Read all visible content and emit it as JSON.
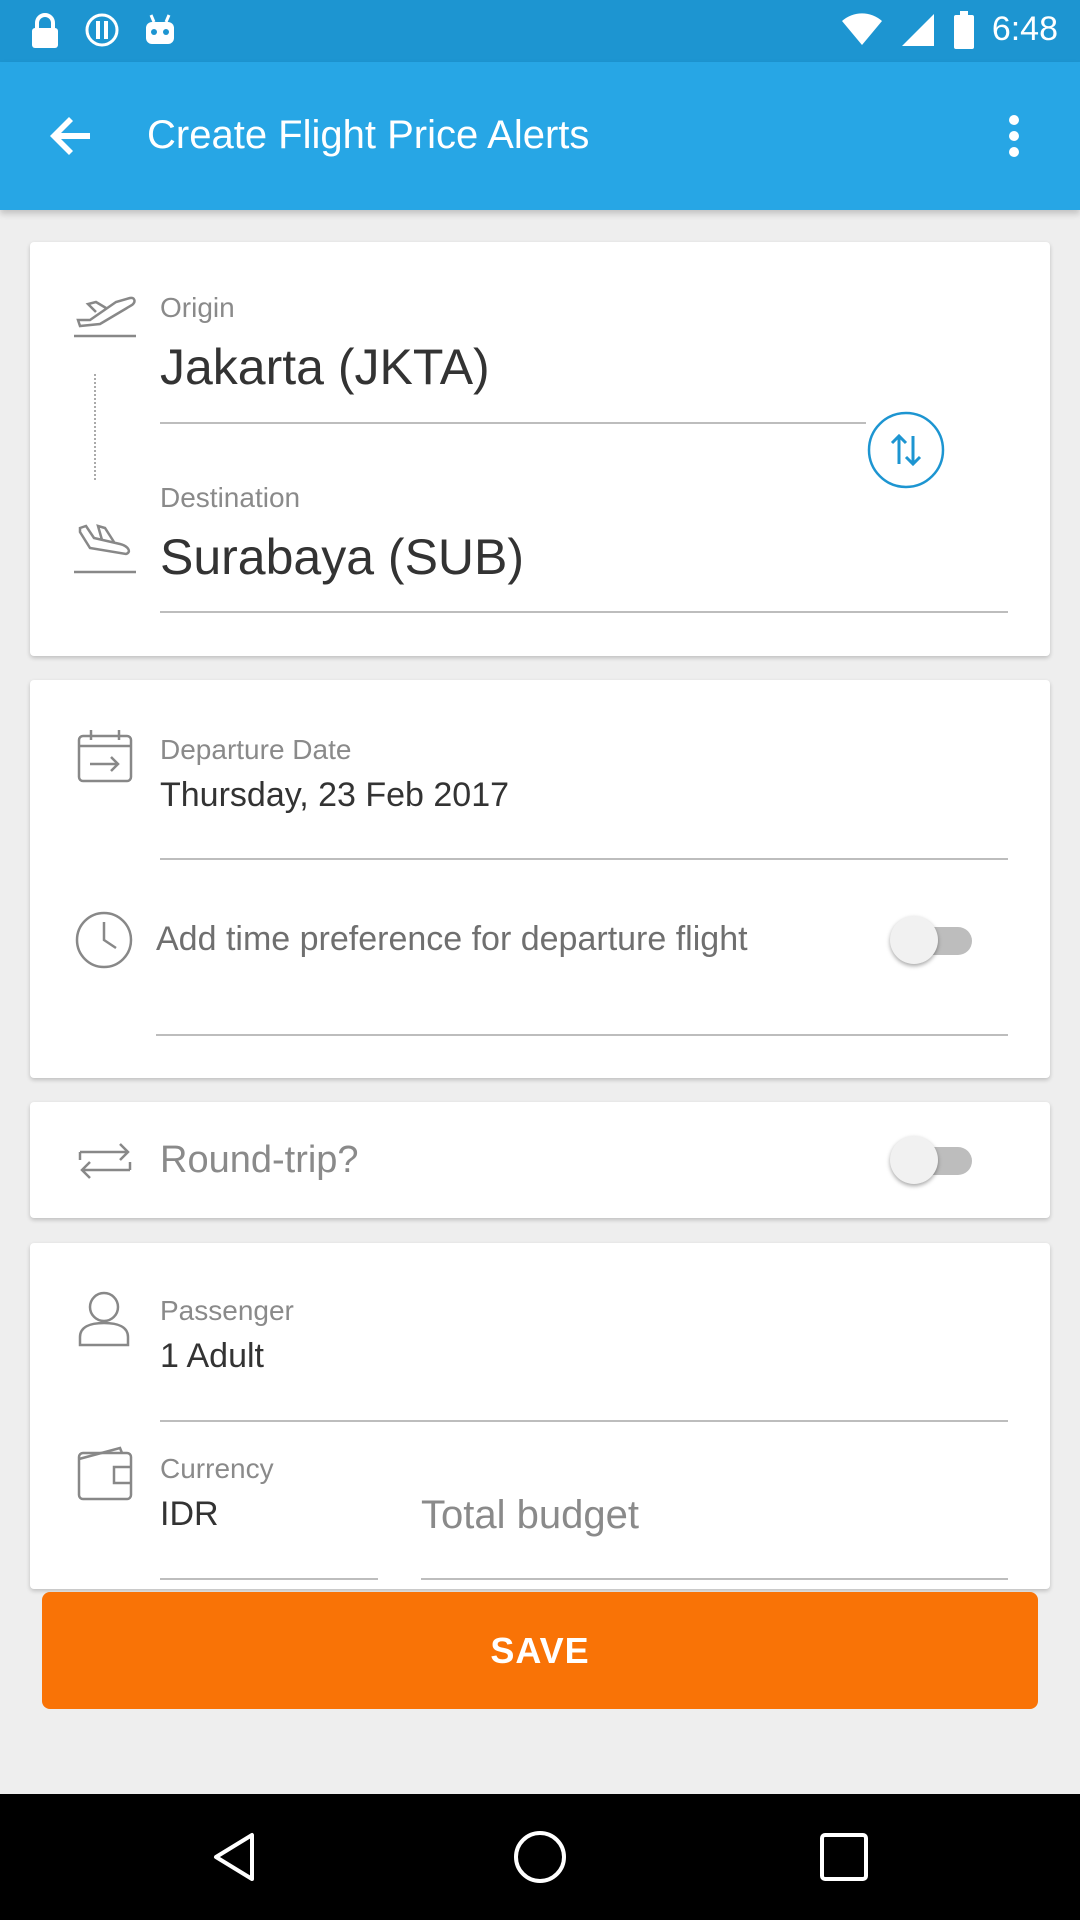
{
  "status_bar": {
    "time": "6:48"
  },
  "app_bar": {
    "title": "Create Flight Price Alerts"
  },
  "route_card": {
    "origin_label": "Origin",
    "origin_value": "Jakarta (JKTA)",
    "destination_label": "Destination",
    "destination_value": "Surabaya (SUB)"
  },
  "date_card": {
    "departure_label": "Departure Date",
    "departure_value": "Thursday, 23 Feb 2017",
    "time_pref_label": "Add time preference for departure flight",
    "time_pref_on": false
  },
  "roundtrip_card": {
    "label": "Round-trip?",
    "on": false
  },
  "passenger_card": {
    "passenger_label": "Passenger",
    "passenger_value": "1 Adult",
    "currency_label": "Currency",
    "currency_value": "IDR",
    "budget_placeholder": "Total budget"
  },
  "save_label": "SAVE",
  "colors": {
    "app_bar": "#27a6e5",
    "status_bar": "#1d95d1",
    "accent": "#1d95d1",
    "save": "#f97306"
  },
  "icons": [
    "lock-icon",
    "info-icon",
    "android-icon",
    "wifi-icon",
    "signal-icon",
    "battery-icon",
    "back-arrow-icon",
    "more-vert-icon",
    "takeoff-icon",
    "landing-icon",
    "swap-icon",
    "calendar-icon",
    "clock-icon",
    "roundtrip-icon",
    "person-icon",
    "wallet-icon",
    "nav-back-icon",
    "nav-home-icon",
    "nav-recents-icon"
  ]
}
